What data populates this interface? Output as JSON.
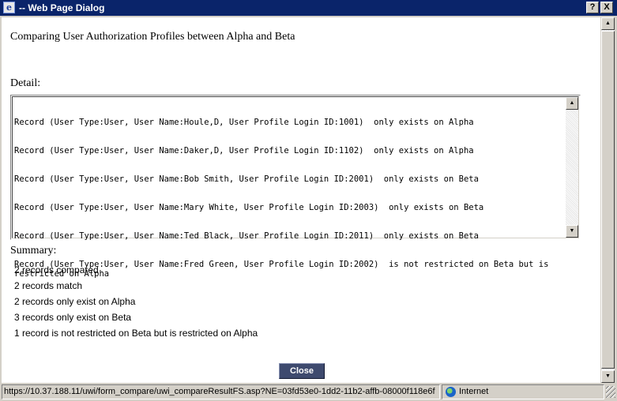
{
  "window": {
    "title": "-- Web Page Dialog",
    "help_label": "?",
    "close_label": "X"
  },
  "main": {
    "heading": "Comparing User Authorization Profiles between Alpha and Beta",
    "detail_label": "Detail:",
    "detail_lines": [
      "Record (User Type:User, User Name:Houle,D, User Profile Login ID:1001)  only exists on Alpha",
      "Record (User Type:User, User Name:Daker,D, User Profile Login ID:1102)  only exists on Alpha",
      "Record (User Type:User, User Name:Bob Smith, User Profile Login ID:2001)  only exists on Beta",
      "Record (User Type:User, User Name:Mary White, User Profile Login ID:2003)  only exists on Beta",
      "Record (User Type:User, User Name:Ted Black, User Profile Login ID:2011)  only exists on Beta",
      "Record (User Type:User, User Name:Fred Green, User Profile Login ID:2002)  is not restricted on Beta but is restricted on Alpha"
    ],
    "summary_label": "Summary:",
    "summary_lines": [
      "2 records compared",
      "2 records match",
      "2 records only exist on Alpha",
      "3 records only exist on Beta",
      "1 record is not restricted on Beta but is restricted on Alpha"
    ],
    "close_button": "Close"
  },
  "statusbar": {
    "url": "https://10.37.188.11/uwi/form_compare/uwi_compareResultFS.asp?NE=03fd53e0-1dd2-11b2-affb-08000f118e6f",
    "zone": "Internet"
  },
  "icons": {
    "window": "ie-page-icon",
    "zone": "globe-icon"
  }
}
